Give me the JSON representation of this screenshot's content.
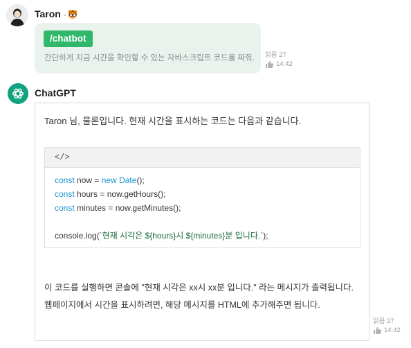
{
  "user_message": {
    "author": "Taron",
    "author_suffix": "-",
    "author_emoji": "🐯",
    "command": "/chatbot",
    "text": "간단하게 지금 시간을 확인할 수 있는 자바스크립트 코드를 짜줘.",
    "read_label": "읽음 27",
    "time": "14:42"
  },
  "bot_message": {
    "author": "ChatGPT",
    "intro": "Taron 님, 물론입니다. 현재 시간을 표시하는 코드는 다음과 같습니다.",
    "code_header": "</>",
    "code_lines": [
      [
        {
          "t": "const",
          "c": "kw"
        },
        {
          "t": " now = "
        },
        {
          "t": "new",
          "c": "kw"
        },
        {
          "t": " "
        },
        {
          "t": "Date",
          "c": "kw"
        },
        {
          "t": "();"
        }
      ],
      [
        {
          "t": "const",
          "c": "kw"
        },
        {
          "t": " hours = now.getHours();"
        }
      ],
      [
        {
          "t": "const",
          "c": "kw"
        },
        {
          "t": " minutes = now.getMinutes();"
        }
      ],
      [],
      [
        {
          "t": "console.log(`"
        },
        {
          "t": "현재 시각은 ${hours}시 ${minutes}분 입니다.",
          "c": "str"
        },
        {
          "t": "`);"
        }
      ]
    ],
    "outro": "이 코드를 실행하면 콘솔에 \"현재 시각은 xx시 xx분 입니다.\" 라는 메시지가 출력됩니다. 웹페이지에서 시간을 표시하려면, 해당 메시지를 HTML에 추가해주면 됩니다.",
    "read_label": "읽음 27",
    "time": "14:42"
  },
  "icons": {
    "like": "thumbs-up-icon",
    "bot_avatar": "openai-logo-icon",
    "user_avatar": "user-avatar"
  },
  "colors": {
    "command_bg": "#2fb86a",
    "user_bubble_bg": "#eaf2ee",
    "bot_avatar_bg": "#10a37f",
    "keyword": "#1a93d2"
  }
}
